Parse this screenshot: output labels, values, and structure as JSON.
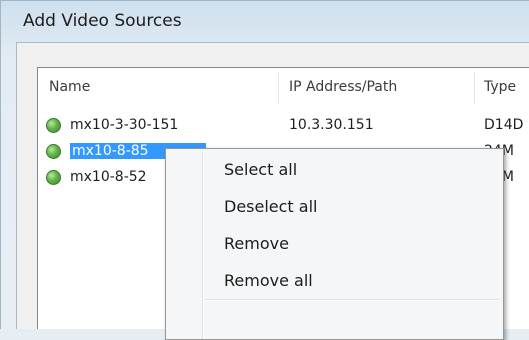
{
  "window": {
    "title": "Add Video Sources"
  },
  "list": {
    "headers": {
      "name": "Name",
      "ip": "IP Address/Path",
      "type": "Type"
    },
    "rows": [
      {
        "name": "mx10-3-30-151",
        "ip": "10.3.30.151",
        "type": "D14D"
      },
      {
        "name": "mx10-8-85",
        "ip": "",
        "type": "24M"
      },
      {
        "name": "mx10-8-52",
        "ip": "",
        "type": "24M"
      }
    ],
    "status_color": "#5cb043",
    "selection_color": "#3399ff"
  },
  "context_menu": {
    "items": [
      {
        "label": "Select all"
      },
      {
        "label": "Deselect all"
      },
      {
        "label": "Remove"
      },
      {
        "label": "Remove all"
      }
    ]
  }
}
